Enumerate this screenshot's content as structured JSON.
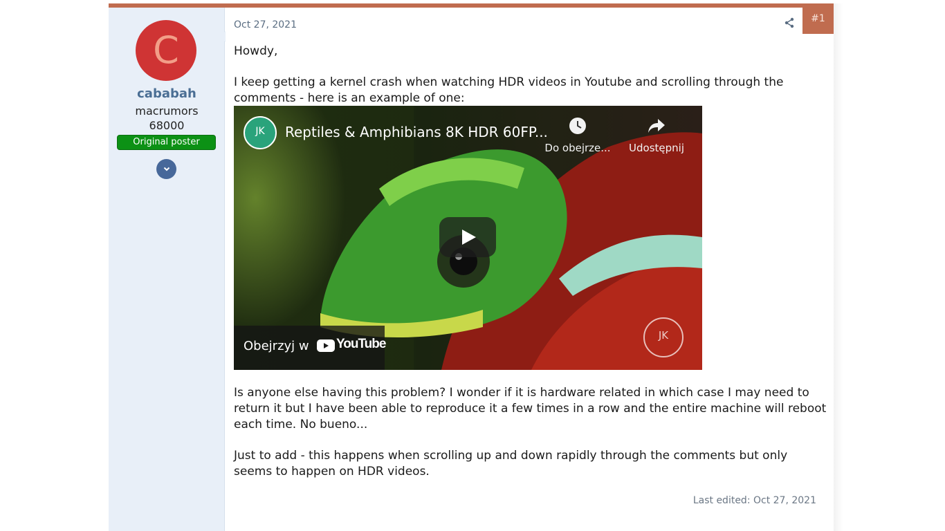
{
  "post": {
    "number": "#1",
    "date": "Oct 27, 2021",
    "last_edited": "Last edited: Oct 27, 2021",
    "share_icon": "share-icon"
  },
  "user": {
    "avatar_letter": "C",
    "name": "cababah",
    "title_line1": "macrumors",
    "title_line2": "68000",
    "badge": "Original poster",
    "expand_icon": "chevron-down-icon"
  },
  "message": {
    "greeting": "Howdy,",
    "p1": "I keep getting a kernel crash when watching HDR videos in Youtube and scrolling through the comments - here is an example of one:",
    "p2": "Is anyone else having this problem? I wonder if it is hardware related in which case I may need to return it but I have been able to reproduce it a few times in a row and the entire machine will reboot each time. No bueno...",
    "p3": "Just to add - this happens when scrolling up and down rapidly through the comments but only seems to happen on HDR videos."
  },
  "video": {
    "title": "Reptiles & Amphibians 8K HDR 60FP...",
    "watch_later": "Do obejrze...",
    "share": "Udostępnij",
    "watch_on": "Obejrzyj w",
    "platform": "YouTube",
    "channel_logo_text": "JK"
  },
  "colors": {
    "accent": "#c06c4f",
    "username": "#4a6e94",
    "badge": "#0c9115",
    "sidebar_bg": "#e8eff8"
  }
}
